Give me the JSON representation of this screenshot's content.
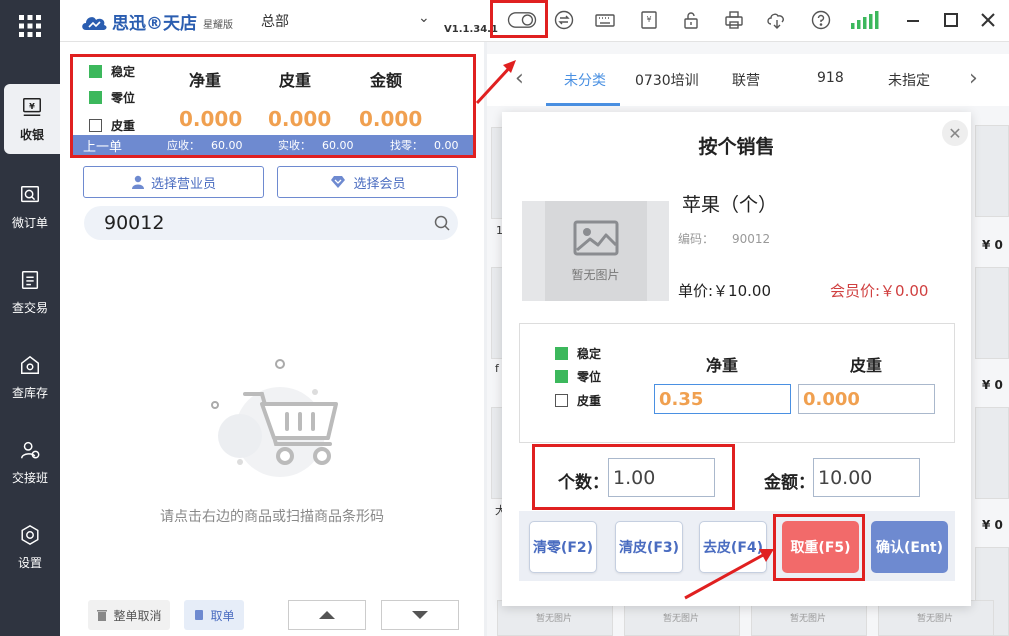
{
  "nav": {
    "items": [
      {
        "label": "收银",
        "icon": "cashier-icon",
        "active": true
      },
      {
        "label": "微订单",
        "icon": "order-icon"
      },
      {
        "label": "查交易",
        "icon": "transaction-icon"
      },
      {
        "label": "查库存",
        "icon": "inventory-icon"
      },
      {
        "label": "交接班",
        "icon": "shift-handover-icon"
      },
      {
        "label": "设置",
        "icon": "settings-icon"
      }
    ]
  },
  "topbar": {
    "brand": "思迅®天店",
    "edition": "星耀版",
    "store": "总部",
    "version": "V1.1.34.1"
  },
  "scale": {
    "stable_label": "稳定",
    "zero_label": "零位",
    "tare_label": "皮重",
    "net_header": "净重",
    "tare_header": "皮重",
    "amount_header": "金额",
    "net_value": "0.000",
    "tare_value": "0.000",
    "amount_value": "0.000",
    "last_order": "上一单",
    "receivable_label": "应收：",
    "receivable": "60.00",
    "received_label": "实收：",
    "received": "60.00",
    "change_label": "找零：",
    "change": "0.00"
  },
  "left": {
    "select_clerk": "选择营业员",
    "select_member": "选择会员",
    "search_value": "90012",
    "empty_tip": "请点击右边的商品或扫描商品条形码",
    "cancel_all": "整单取消",
    "hold": "取单"
  },
  "categories": {
    "tabs": [
      "未分类",
      "0730培训",
      "联营",
      "918",
      "未指定"
    ],
    "active_index": 0
  },
  "tiles": {
    "price_symbol": "¥ 0",
    "no_image": "暂无图片",
    "partial_labels": [
      "1",
      "f",
      "大"
    ]
  },
  "dialog": {
    "title": "按个销售",
    "product_name": "苹果（个）",
    "code_label": "编码：",
    "code": "90012",
    "no_image": "暂无图片",
    "unit_price": "单价:￥10.00",
    "member_price": "会员价:￥0.00",
    "stable_label": "稳定",
    "zero_label": "零位",
    "tare_label": "皮重",
    "net_header": "净重",
    "tare_header": "皮重",
    "net_value": "0.35",
    "tare_value": "0.000",
    "qty_label": "个数：",
    "qty_value": "1.00",
    "amount_label": "金额：",
    "amount_value": "10.00",
    "buttons": {
      "clear_zero": "清零(F2)",
      "clear_tare": "清皮(F3)",
      "remove_tare": "去皮(F4)",
      "take_tare": "取重(F5)",
      "confirm": "确认(Ent)"
    }
  },
  "colors": {
    "nav_bg": "#2f3440",
    "accent": "#4a90e2",
    "scale_value": "#f0a050",
    "highlight": "#e02020",
    "primary_button": "#6e8ad0",
    "danger_button": "#f26a6a",
    "signal": "#3cb85c"
  }
}
